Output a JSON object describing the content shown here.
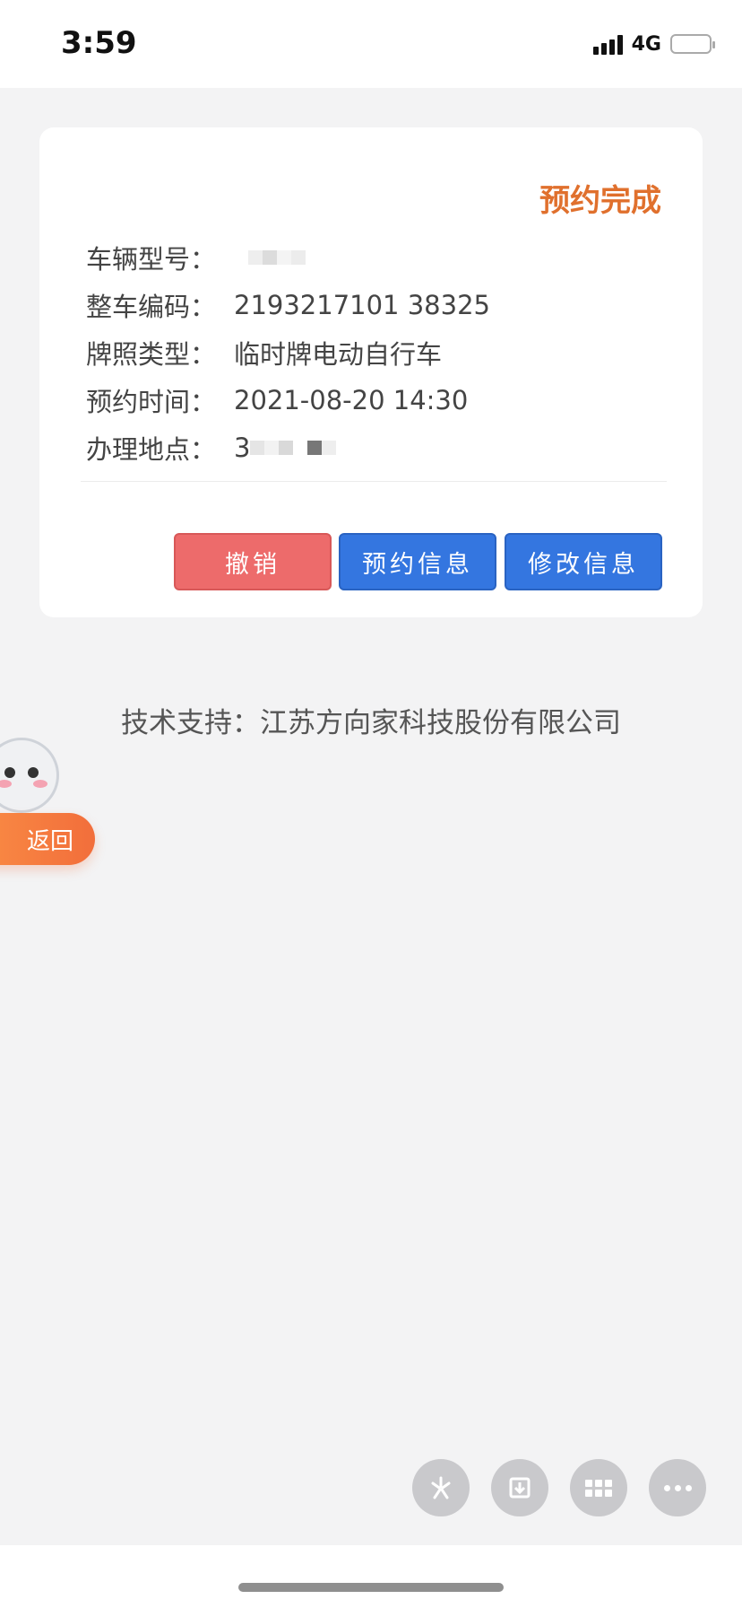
{
  "status_bar": {
    "time": "3:59",
    "network": "4G"
  },
  "card": {
    "status": "预约完成",
    "rows": [
      {
        "label": "车辆型号：",
        "value": ""
      },
      {
        "label": "整车编码：",
        "value": "2193217101 38325"
      },
      {
        "label": "牌照类型：",
        "value": "临时牌电动自行车"
      },
      {
        "label": "预约时间：",
        "value": "2021-08-20 14:30"
      },
      {
        "label": "办理地点：",
        "value": "3"
      }
    ],
    "buttons": {
      "cancel": "撤销",
      "booking_info": "预约信息",
      "edit_info": "修改信息"
    }
  },
  "support": "技术支持：江苏方向家科技股份有限公司",
  "back_button": "返回",
  "fab_icons": [
    "sparkle-icon",
    "download-icon",
    "grid-icon",
    "more-icon"
  ],
  "colors": {
    "status": "#e0702d",
    "cancel": "#ed6b6b",
    "primary": "#3476e0",
    "back": "#f26e3b"
  }
}
